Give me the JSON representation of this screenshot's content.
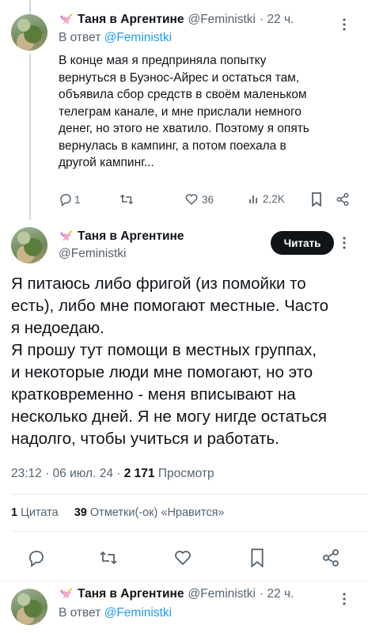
{
  "reply_tweet": {
    "author": "Таня в Аргентине",
    "handle": "@Feministki",
    "time": "· 22 ч.",
    "reply_prefix": "В ответ",
    "reply_to": "@Feministki",
    "text_lines": [
      "В конце мая я предприняла попытку",
      "вернуться в Буэнос-Айрес и остаться там,",
      "объявила сбор средств в своём маленьком",
      "телеграм канале, и мне прислали немного",
      "денег, но этого не хватило. Поэтому я опять",
      "вернулась в кампинг, а потом поехала в",
      "другой кампинг..."
    ],
    "replies": "1",
    "retweets": "",
    "likes": "36",
    "views": "2,2K",
    "more_icon": "more-dots-icon"
  },
  "main_tweet": {
    "author": "Таня в Аргентине",
    "handle": "@Feministki",
    "follow_label": "Читать",
    "text_lines": [
      "Я питаюсь либо фригой (из помойки то",
      "есть), либо мне помогают местные. Часто",
      "я недоедаю.",
      "Я прошу тут помощи в местных группах,",
      "и некоторые люди мне помогают, но это",
      "кратковременно - меня вписывают на",
      "несколько дней. Я не могу нигде  остаться",
      "надолго, чтобы учиться и работать."
    ],
    "timestamp": "23:12 · 06 июл. 24 · ",
    "views_count": "2 171",
    "views_label": " Просмотр",
    "quotes_count": "1",
    "quotes_label": " Цитата",
    "likes_count": "39",
    "likes_label": " Отметки(-ок) «Нравится»"
  },
  "next_tweet": {
    "author": "Таня в Аргентине",
    "handle": "@Feministki",
    "time": "· 22 ч.",
    "reply_prefix": "В ответ",
    "reply_to": "@Feministki"
  }
}
